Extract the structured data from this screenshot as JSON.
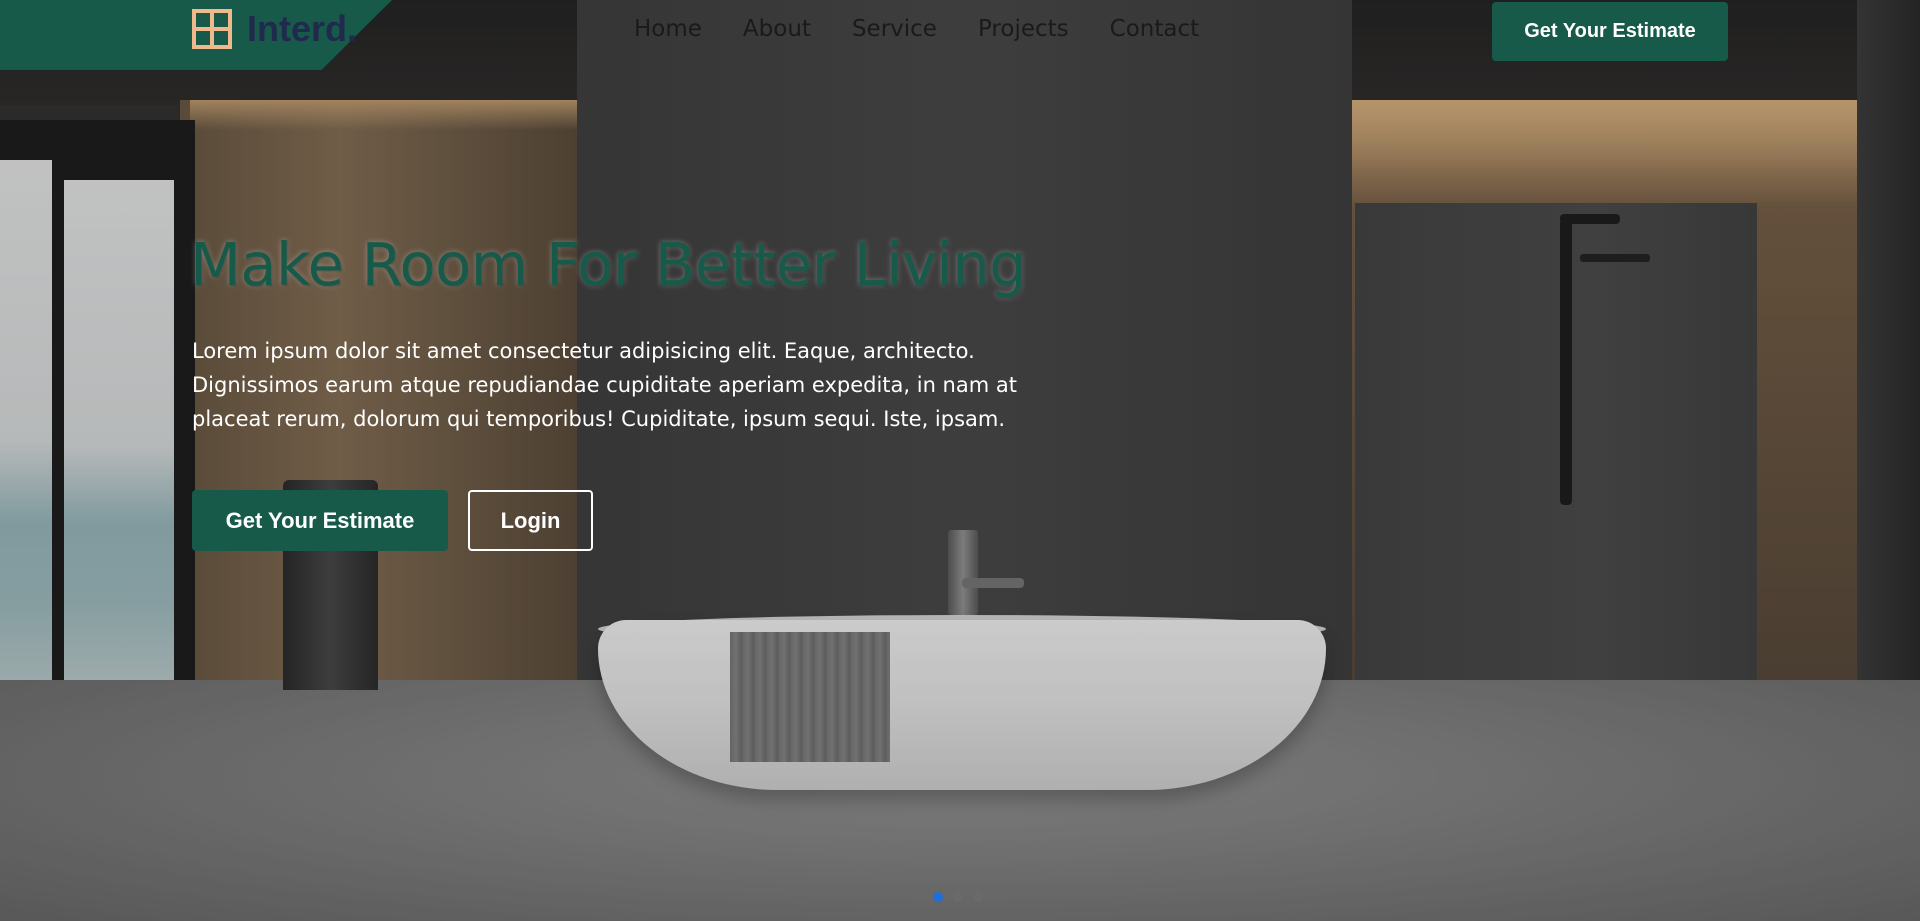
{
  "brand": {
    "name": "Interd.",
    "icon": "window-grid-icon"
  },
  "nav": {
    "items": [
      {
        "label": "Home"
      },
      {
        "label": "About"
      },
      {
        "label": "Service"
      },
      {
        "label": "Projects"
      },
      {
        "label": "Contact"
      }
    ],
    "cta_label": "Get Your Estimate"
  },
  "hero": {
    "title": "Make Room For Better Living",
    "description": "Lorem ipsum dolor sit amet consectetur adipisicing elit. Eaque, architecto. Dignissimos earum atque repudiandae cupiditate aperiam expedita, in nam at placeat rerum, dolorum qui temporibus! Cupiditate, ipsum sequi. Iste, ipsam.",
    "primary_button": "Get Your Estimate",
    "secondary_button": "Login"
  },
  "carousel": {
    "slides": 3,
    "active_index": 0
  },
  "colors": {
    "brand": "#175a4a",
    "logo_icon": "#f0b98c",
    "logo_text": "#1f2a4d",
    "active_dot": "#1e6fd9"
  }
}
